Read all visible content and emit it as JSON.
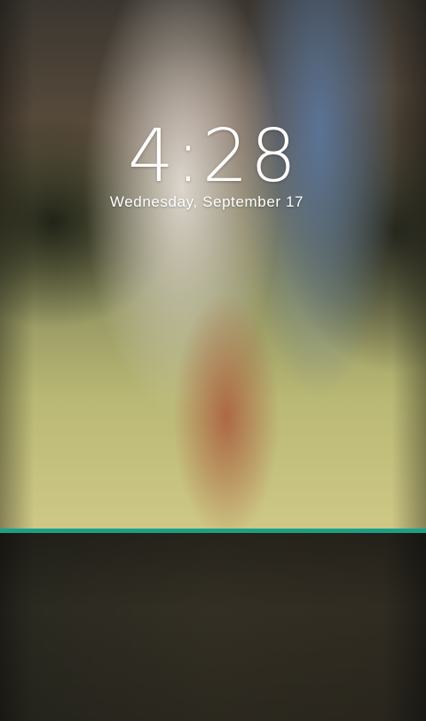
{
  "lockscreen": {
    "time": "4:28",
    "date": "Wednesday, September 17"
  },
  "colors": {
    "accent_line": "#1aa086",
    "lower_panel": "#2f2c22"
  }
}
